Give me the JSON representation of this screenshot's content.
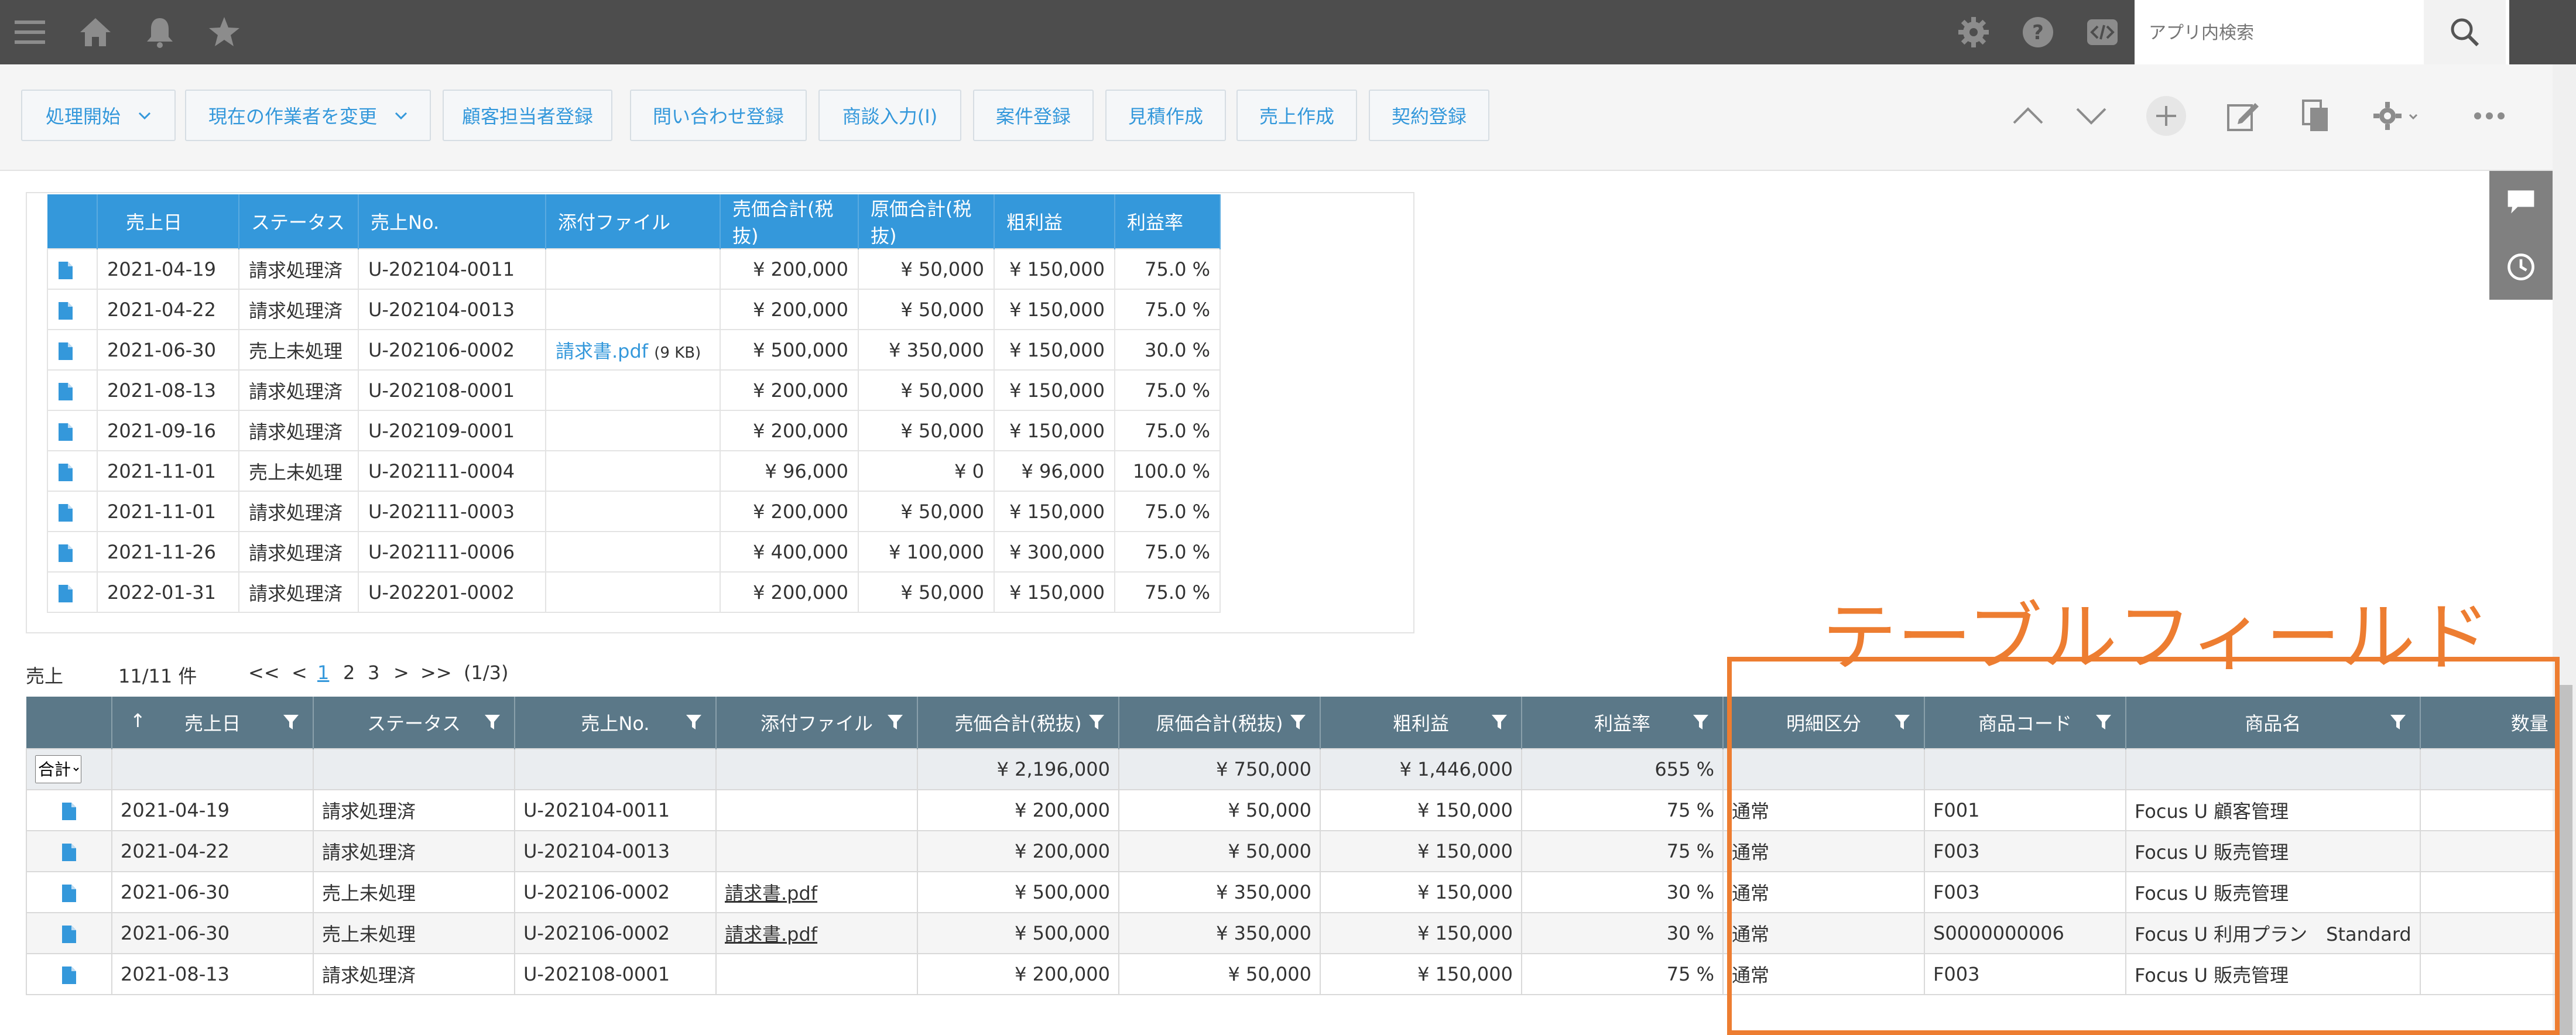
{
  "header": {
    "search_placeholder": "アプリ内検索",
    "icons": [
      "menu-icon",
      "home-icon",
      "bell-icon",
      "star-icon",
      "gear-icon",
      "help-icon",
      "code-icon",
      "search-icon"
    ]
  },
  "actions": {
    "buttons": [
      "処理開始",
      "現在の作業者を変更",
      "顧客担当者登録",
      "問い合わせ登録",
      "商談入力(I)",
      "案件登録",
      "見積作成",
      "売上作成",
      "契約登録"
    ]
  },
  "related_table": {
    "headers": [
      "売上日",
      "ステータス",
      "売上No.",
      "添付ファイル",
      "売価合計(税抜)",
      "原価合計(税抜)",
      "粗利益",
      "利益率"
    ],
    "rows": [
      {
        "date": "2021-04-19",
        "status": "請求処理済",
        "no": "U-202104-0011",
        "file": "",
        "size": "",
        "sales": "¥ 200,000",
        "cost": "¥ 50,000",
        "profit": "¥ 150,000",
        "rate": "75.0 %"
      },
      {
        "date": "2021-04-22",
        "status": "請求処理済",
        "no": "U-202104-0013",
        "file": "",
        "size": "",
        "sales": "¥ 200,000",
        "cost": "¥ 50,000",
        "profit": "¥ 150,000",
        "rate": "75.0 %"
      },
      {
        "date": "2021-06-30",
        "status": "売上未処理",
        "no": "U-202106-0002",
        "file": "請求書.pdf",
        "size": "(9 KB)",
        "sales": "¥ 500,000",
        "cost": "¥ 350,000",
        "profit": "¥ 150,000",
        "rate": "30.0 %"
      },
      {
        "date": "2021-08-13",
        "status": "請求処理済",
        "no": "U-202108-0001",
        "file": "",
        "size": "",
        "sales": "¥ 200,000",
        "cost": "¥ 50,000",
        "profit": "¥ 150,000",
        "rate": "75.0 %"
      },
      {
        "date": "2021-09-16",
        "status": "請求処理済",
        "no": "U-202109-0001",
        "file": "",
        "size": "",
        "sales": "¥ 200,000",
        "cost": "¥ 50,000",
        "profit": "¥ 150,000",
        "rate": "75.0 %"
      },
      {
        "date": "2021-11-01",
        "status": "売上未処理",
        "no": "U-202111-0004",
        "file": "",
        "size": "",
        "sales": "¥ 96,000",
        "cost": "¥ 0",
        "profit": "¥ 96,000",
        "rate": "100.0 %"
      },
      {
        "date": "2021-11-01",
        "status": "請求処理済",
        "no": "U-202111-0003",
        "file": "",
        "size": "",
        "sales": "¥ 200,000",
        "cost": "¥ 50,000",
        "profit": "¥ 150,000",
        "rate": "75.0 %"
      },
      {
        "date": "2021-11-26",
        "status": "請求処理済",
        "no": "U-202111-0006",
        "file": "",
        "size": "",
        "sales": "¥ 400,000",
        "cost": "¥ 100,000",
        "profit": "¥ 300,000",
        "rate": "75.0 %"
      },
      {
        "date": "2022-01-31",
        "status": "請求処理済",
        "no": "U-202201-0002",
        "file": "",
        "size": "",
        "sales": "¥ 200,000",
        "cost": "¥ 50,000",
        "profit": "¥ 150,000",
        "rate": "75.0 %"
      }
    ]
  },
  "pager": {
    "label": "売上",
    "count": "11/11 件",
    "first": "<<",
    "prev": "<",
    "pages": [
      "1",
      "2",
      "3"
    ],
    "next": ">",
    "last": ">>",
    "page_info": "(1/3)"
  },
  "list_table": {
    "headers": [
      "売上日",
      "ステータス",
      "売上No.",
      "添付ファイル",
      "売価合計(税抜)",
      "原価合計(税抜)",
      "粗利益",
      "利益率",
      "明細区分",
      "商品コード",
      "商品名",
      "数量"
    ],
    "sort_icon": "↑",
    "aggregate_select": "合計",
    "totals": {
      "sales": "¥ 2,196,000",
      "cost": "¥ 750,000",
      "profit": "¥ 1,446,000",
      "rate": "655 %"
    },
    "rows": [
      {
        "date": "2021-04-19",
        "status": "請求処理済",
        "no": "U-202104-0011",
        "file": "",
        "sales": "¥ 200,000",
        "cost": "¥ 50,000",
        "profit": "¥ 150,000",
        "rate": "75 %",
        "kind": "通常",
        "code": "F001",
        "name": "Focus U 顧客管理",
        "qty": ""
      },
      {
        "date": "2021-04-22",
        "status": "請求処理済",
        "no": "U-202104-0013",
        "file": "",
        "sales": "¥ 200,000",
        "cost": "¥ 50,000",
        "profit": "¥ 150,000",
        "rate": "75 %",
        "kind": "通常",
        "code": "F003",
        "name": "Focus U 販売管理",
        "qty": ""
      },
      {
        "date": "2021-06-30",
        "status": "売上未処理",
        "no": "U-202106-0002",
        "file": "請求書.pdf",
        "sales": "¥ 500,000",
        "cost": "¥ 350,000",
        "profit": "¥ 150,000",
        "rate": "30 %",
        "kind": "通常",
        "code": "F003",
        "name": "Focus U 販売管理",
        "qty": ""
      },
      {
        "date": "2021-06-30",
        "status": "売上未処理",
        "no": "U-202106-0002",
        "file": "請求書.pdf",
        "sales": "¥ 500,000",
        "cost": "¥ 350,000",
        "profit": "¥ 150,000",
        "rate": "30 %",
        "kind": "通常",
        "code": "S0000000006",
        "name": "Focus U 利用プラン　Standard",
        "qty": ""
      },
      {
        "date": "2021-08-13",
        "status": "請求処理済",
        "no": "U-202108-0001",
        "file": "",
        "sales": "¥ 200,000",
        "cost": "¥ 50,000",
        "profit": "¥ 150,000",
        "rate": "75 %",
        "kind": "通常",
        "code": "F003",
        "name": "Focus U 販売管理",
        "qty": ""
      }
    ]
  },
  "annotation": {
    "title": "テーブルフィールド",
    "color": "#ed7d31"
  },
  "colors": {
    "header_bg": "#4d4d4d",
    "accent": "#3498db",
    "list_header_bg": "#5b7888"
  }
}
